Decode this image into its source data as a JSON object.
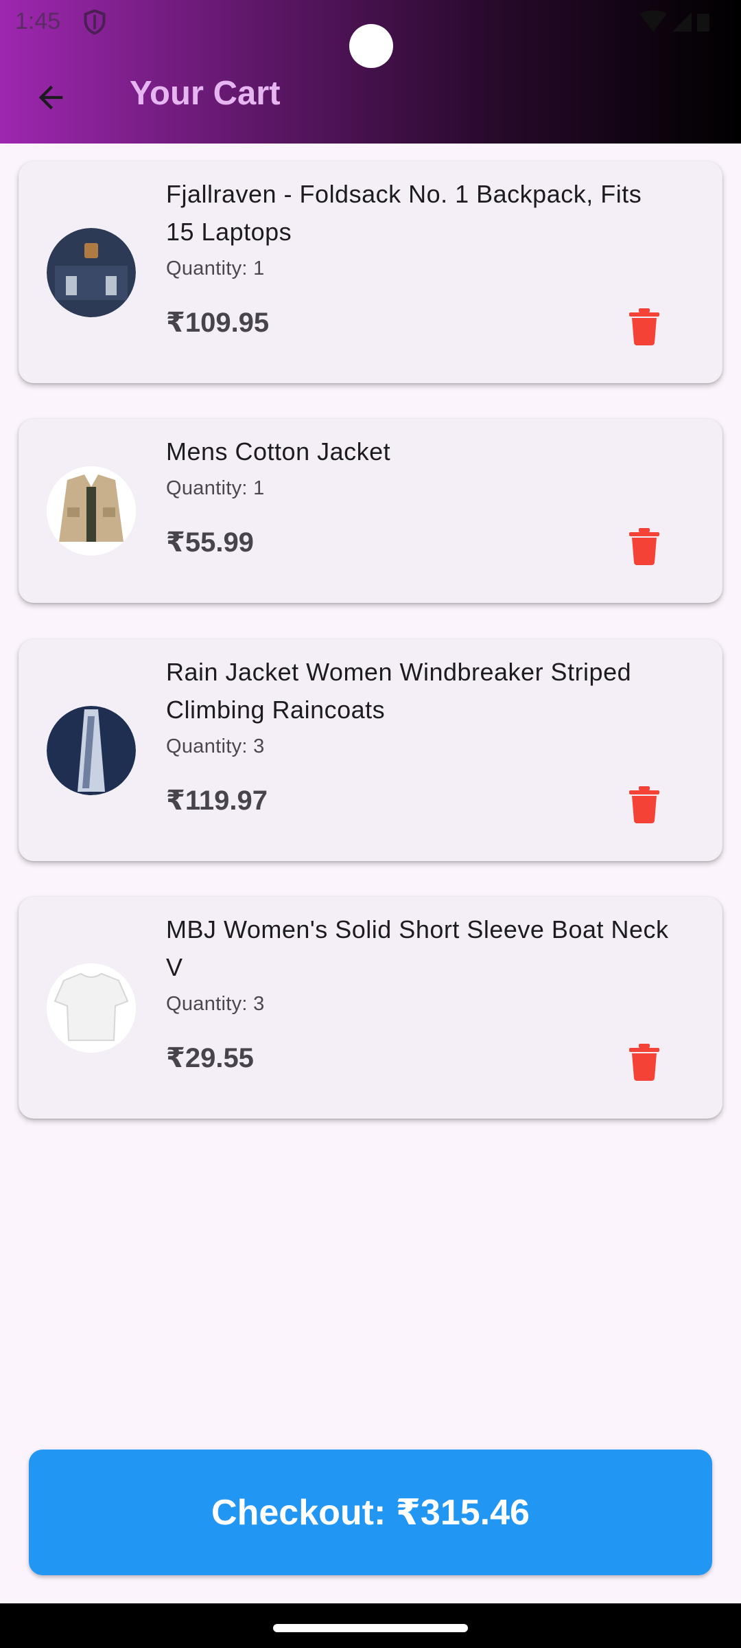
{
  "status_bar": {
    "time": "1:45"
  },
  "header": {
    "title": "Your Cart"
  },
  "cart": {
    "items": [
      {
        "title": "Fjallraven - Foldsack No. 1 Backpack, Fits 15 Laptops",
        "quantity": "Quantity: 1",
        "price": "₹109.95"
      },
      {
        "title": "Mens Cotton Jacket",
        "quantity": "Quantity: 1",
        "price": "₹55.99"
      },
      {
        "title": "Rain Jacket Women Windbreaker Striped Climbing Raincoats",
        "quantity": "Quantity: 3",
        "price": "₹119.97"
      },
      {
        "title": "MBJ Women's Solid Short Sleeve Boat Neck V",
        "quantity": "Quantity: 3",
        "price": "₹29.55"
      }
    ]
  },
  "checkout": {
    "label": "Checkout: ₹315.46"
  },
  "colors": {
    "accent": "#2196f3",
    "delete": "#f44336",
    "header_start": "#9e27b0",
    "header_end": "#000000"
  },
  "icons": {
    "back": "arrow-left-icon",
    "delete": "trash-icon"
  }
}
